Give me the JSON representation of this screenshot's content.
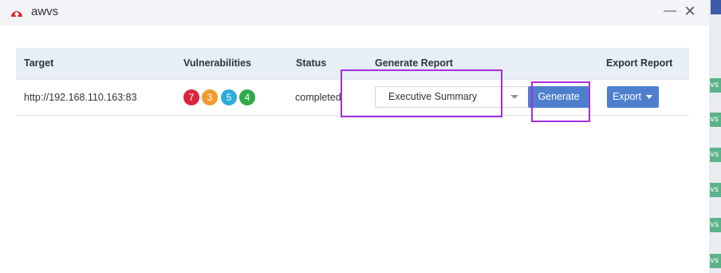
{
  "window": {
    "title": "awvs",
    "minimize_glyph": "—",
    "close_glyph": "✕",
    "logo_icon": "awvs-logo-icon"
  },
  "colors": {
    "accent": "#4e7fcf",
    "header_bg": "#e8eef7",
    "highlight": "#a52ee0",
    "severity_high": "#d7263d",
    "severity_medium": "#f19a2e",
    "severity_low": "#2eaad9",
    "severity_info": "#2eaa4a"
  },
  "table": {
    "headers": {
      "target": "Target",
      "vulnerabilities": "Vulnerabilities",
      "status": "Status",
      "generate_report": "Generate Report",
      "export_report": "Export Report"
    },
    "rows": [
      {
        "target": "http://192.168.110.163:83",
        "vulns": {
          "high": "7",
          "medium": "3",
          "low": "5",
          "info": "4"
        },
        "status": "completed",
        "report_template": "Executive Summary",
        "generate_label": "Generate",
        "export_label": "Export"
      }
    ]
  },
  "background": {
    "tab_text": "vs"
  }
}
